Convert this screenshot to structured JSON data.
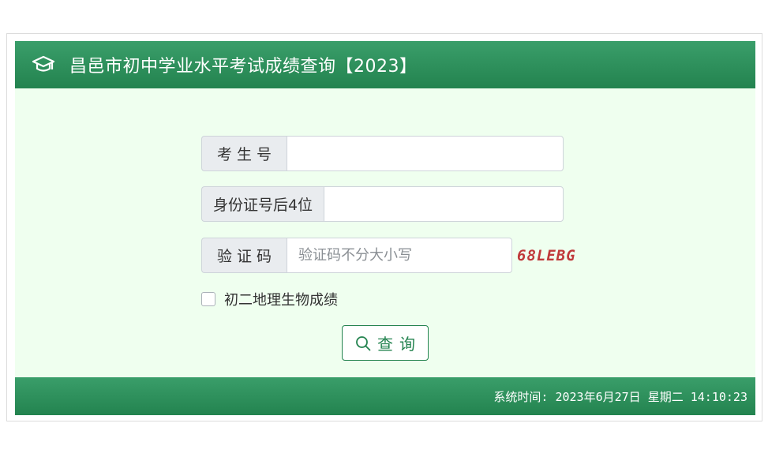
{
  "header": {
    "title": "昌邑市初中学业水平考试成绩查询【2023】",
    "icon": "graduation-cap-icon"
  },
  "form": {
    "exam_number_label": "考 生 号",
    "exam_number_value": "",
    "id_last4_label": "身份证号后4位",
    "id_last4_value": "",
    "captcha_label": "验 证 码",
    "captcha_placeholder": "验证码不分大小写",
    "captcha_code": "68LEBG",
    "checkbox_label": "初二地理生物成绩",
    "checkbox_checked": false,
    "submit_label": "查询"
  },
  "footer": {
    "system_time": "系统时间: 2023年6月27日 星期二 14:10:23"
  },
  "colors": {
    "header_green": "#23834f",
    "card_bg": "#efffef",
    "captcha_red": "#c0393b"
  }
}
